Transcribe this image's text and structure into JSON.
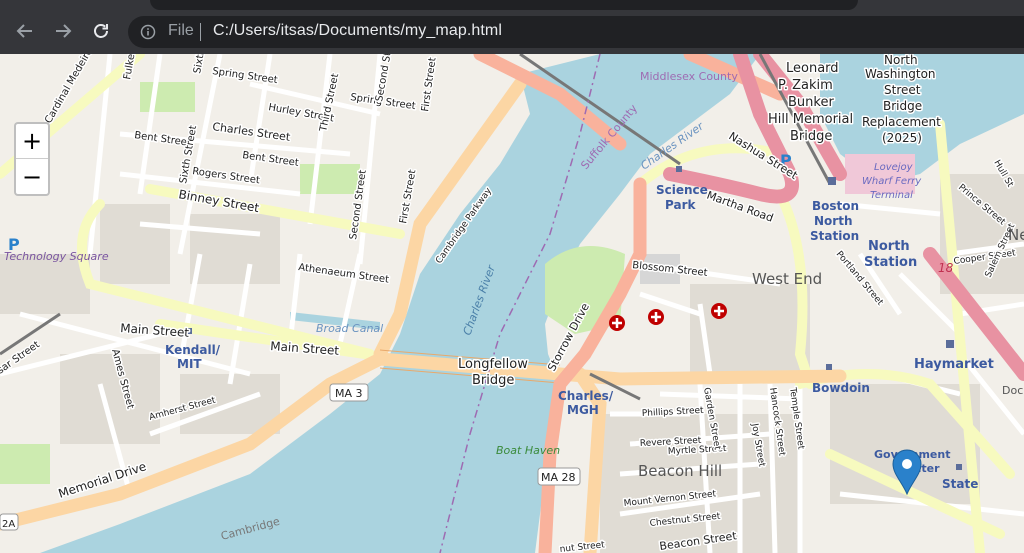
{
  "browser": {
    "scheme_label": "File",
    "url": "C:/Users/itsas/Documents/my_map.html",
    "icons": [
      "back-arrow-icon",
      "forward-arrow-icon",
      "reload-icon",
      "info-icon"
    ]
  },
  "map": {
    "zoom_in_label": "+",
    "zoom_out_label": "−",
    "colors": {
      "water": "#aad3df",
      "land": "#f2efe9",
      "major_road": "#fcd6a4",
      "trunk_road": "#f9b29c",
      "motorway": "#e892a2",
      "minor_road": "#ffffff",
      "secondary_road": "#f7fabf",
      "park": "#cdebb0",
      "marker": "#2a81cb",
      "hospital": "#bf0000"
    },
    "labels": {
      "fulkerson": "Fulkerson",
      "sixth_top": "Sixth",
      "spring_st": "Spring Street",
      "spring_st2": "Spring Street",
      "hurley": "Hurley Street",
      "third": "Third Street",
      "second_top": "Second Street",
      "first": "First Street",
      "cardinal": "Cardinal Medeiros",
      "charles_st": "Charles Street",
      "bent_st": "Bent Street",
      "bent_st2": "Bent Street",
      "sixth_st": "Sixth Street",
      "rogers": "Rogers Street",
      "binney": "Binney Street",
      "second_st": "Second Street",
      "first_st": "First Street",
      "cambridge_pkwy": "Cambridge Parkway",
      "athenaeum": "Athenaeum Street",
      "broad_canal": "Broad Canal",
      "tech_square": "Technology Square",
      "main_st": "Main Street",
      "main_st2": "Main Street",
      "kendall": "Kendall/",
      "mit": "MIT",
      "essex_st": "sar Street",
      "ames": "Ames Street",
      "amherst": "Amherst Street",
      "ma3": "MA 3",
      "memorial": "Memorial Drive",
      "shield_2a": "2A",
      "cambridge": "Cambridge",
      "charles_river": "Charles River",
      "charles_river2": "Charles River",
      "longfellow1": "Longfellow",
      "longfellow2": "Bridge",
      "storrow": "Storrow Drive",
      "charles_mgh1": "Charles/",
      "charles_mgh2": "MGH",
      "boat_haven": "Boat Haven",
      "ma28": "MA 28",
      "middlesex": "Middlesex County",
      "suffolk": "Suffolk County",
      "zakim1": "Leonard",
      "zakim2": "P. Zakim",
      "zakim3": "Bunker",
      "zakim4": "Hill Memorial",
      "zakim5": "Bridge",
      "nwsb1": "North",
      "nwsb2": "Washington",
      "nwsb3": "Street",
      "nwsb4": "Bridge",
      "nwsb5": "Replacement",
      "nwsb6": "(2025)",
      "nashua": "Nashua Street",
      "science1": "Science",
      "science2": "Park",
      "martha": "Martha Road",
      "lovejoy1": "Lovejoy",
      "lovejoy2": "Wharf Ferry",
      "lovejoy3": "Terminal",
      "boston_north1": "Boston",
      "boston_north2": "North",
      "boston_north3": "Station",
      "north_station1": "North",
      "north_station2": "Station",
      "hull": "Hull St",
      "prince": "Prince Street",
      "cooper": "Cooper Street",
      "salem": "Salem Street",
      "portland": "Portland Street",
      "route18": "18",
      "blossom": "Blossom Street",
      "west_end": "West End",
      "haymarket": "Haymarket",
      "bowdoin": "Bowdoin",
      "phillips": "Phillips Street",
      "revere": "Revere Street",
      "myrtle": "Myrtle Street",
      "garden": "Garden Street",
      "joy": "Joy Street",
      "hancock": "Hancock Street",
      "temple": "Temple Street",
      "beacon_hill": "Beacon Hill",
      "mt_vernon": "Mount Vernon Street",
      "chestnut": "Chestnut Street",
      "beacon_st": "Beacon Street",
      "ut_street": "nut Street",
      "gov_center1": "Government",
      "gov_center2": "Center",
      "state": "State",
      "dock": "Doc",
      "ne": "Ne"
    }
  }
}
